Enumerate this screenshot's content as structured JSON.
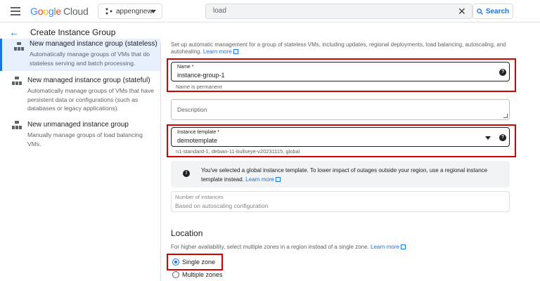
{
  "topbar": {
    "logo": {
      "google": "Google",
      "cloud": "Cloud"
    },
    "project": {
      "name": "appengnew",
      "icon": "project-dots-icon"
    },
    "search": {
      "value": "load",
      "clear_icon": "close-icon",
      "button_label": "Search",
      "button_icon": "search-icon"
    },
    "menu_icon": "hamburger-menu-icon"
  },
  "page": {
    "title": "Create Instance Group",
    "back_icon": "arrow-back-icon"
  },
  "sidebar": {
    "items": [
      {
        "title": "New managed instance group (stateless)",
        "desc": [
          "Automatically manage groups of VMs that do",
          "stateless serving and batch processing."
        ],
        "icon": "instance-group-icon",
        "active": true
      },
      {
        "title": "New managed instance group (stateful)",
        "desc": [
          "Automatically manage groups of VMs that have",
          "persistent data or configurations (such as",
          "databases or legacy applications)."
        ],
        "icon": "instance-group-icon",
        "active": false
      },
      {
        "title": "New unmanaged instance group",
        "desc": [
          "Manually manage groups of load balancing",
          "VMs."
        ],
        "icon": "instance-group-icon",
        "active": false
      }
    ]
  },
  "form": {
    "intro": "Set up automatic management for a group of stateless VMs, including updates, regional deployments, load balancing, autoscaling, and autohealing.",
    "intro_link": "Learn more",
    "name": {
      "label": "Name *",
      "value": "instance-group-1",
      "hint": "Name is permanent"
    },
    "description": {
      "placeholder": "Description"
    },
    "template": {
      "label": "Instance template *",
      "value": "demotemplate",
      "hint": "n1-standard-1, debian-11-bullseye-v20231115, global"
    },
    "info": {
      "line1": "You've selected a global instance template. To lower impact of outages outside your region, use a regional instance",
      "line2": "template instead.",
      "link": "Learn more"
    },
    "instances": {
      "label": "Number of instances",
      "value": "Based on autoscaling configuration"
    }
  },
  "location": {
    "title": "Location",
    "desc": "For higher availability, select multiple zones in a region instead of a single zone.",
    "link": "Learn more",
    "options": [
      {
        "label": "Single zone",
        "checked": true
      },
      {
        "label": "Multiple zones",
        "checked": false
      }
    ]
  },
  "colors": {
    "accent": "#1a73e8",
    "highlight": "#d50000"
  }
}
